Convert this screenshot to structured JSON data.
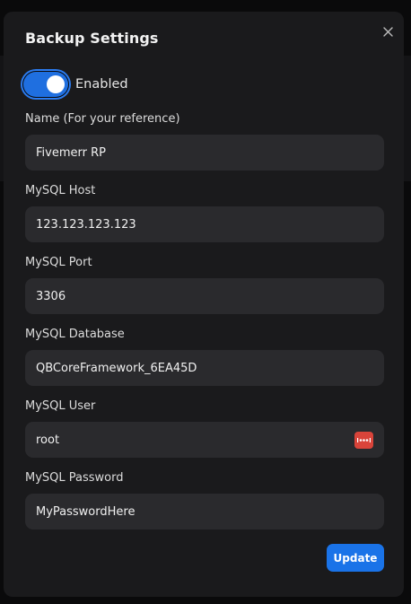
{
  "modal": {
    "title": "Backup Settings",
    "close_icon": "close-icon"
  },
  "toggle": {
    "label": "Enabled",
    "state": true,
    "accent": "#1f6fe0"
  },
  "fields": {
    "name": {
      "label": "Name (For your reference)",
      "value": "Fivemerr RP"
    },
    "host": {
      "label": "MySQL Host",
      "value": "123.123.123.123"
    },
    "port": {
      "label": "MySQL Port",
      "value": "3306"
    },
    "database": {
      "label": "MySQL Database",
      "value": "QBCoreFramework_6EA45D"
    },
    "user": {
      "label": "MySQL User",
      "value": "root",
      "icon": "password-manager-icon",
      "icon_color": "#d9443a"
    },
    "password": {
      "label": "MySQL Password",
      "value": "MyPasswordHere"
    }
  },
  "actions": {
    "update_label": "Update",
    "update_color": "#1a73e8"
  }
}
